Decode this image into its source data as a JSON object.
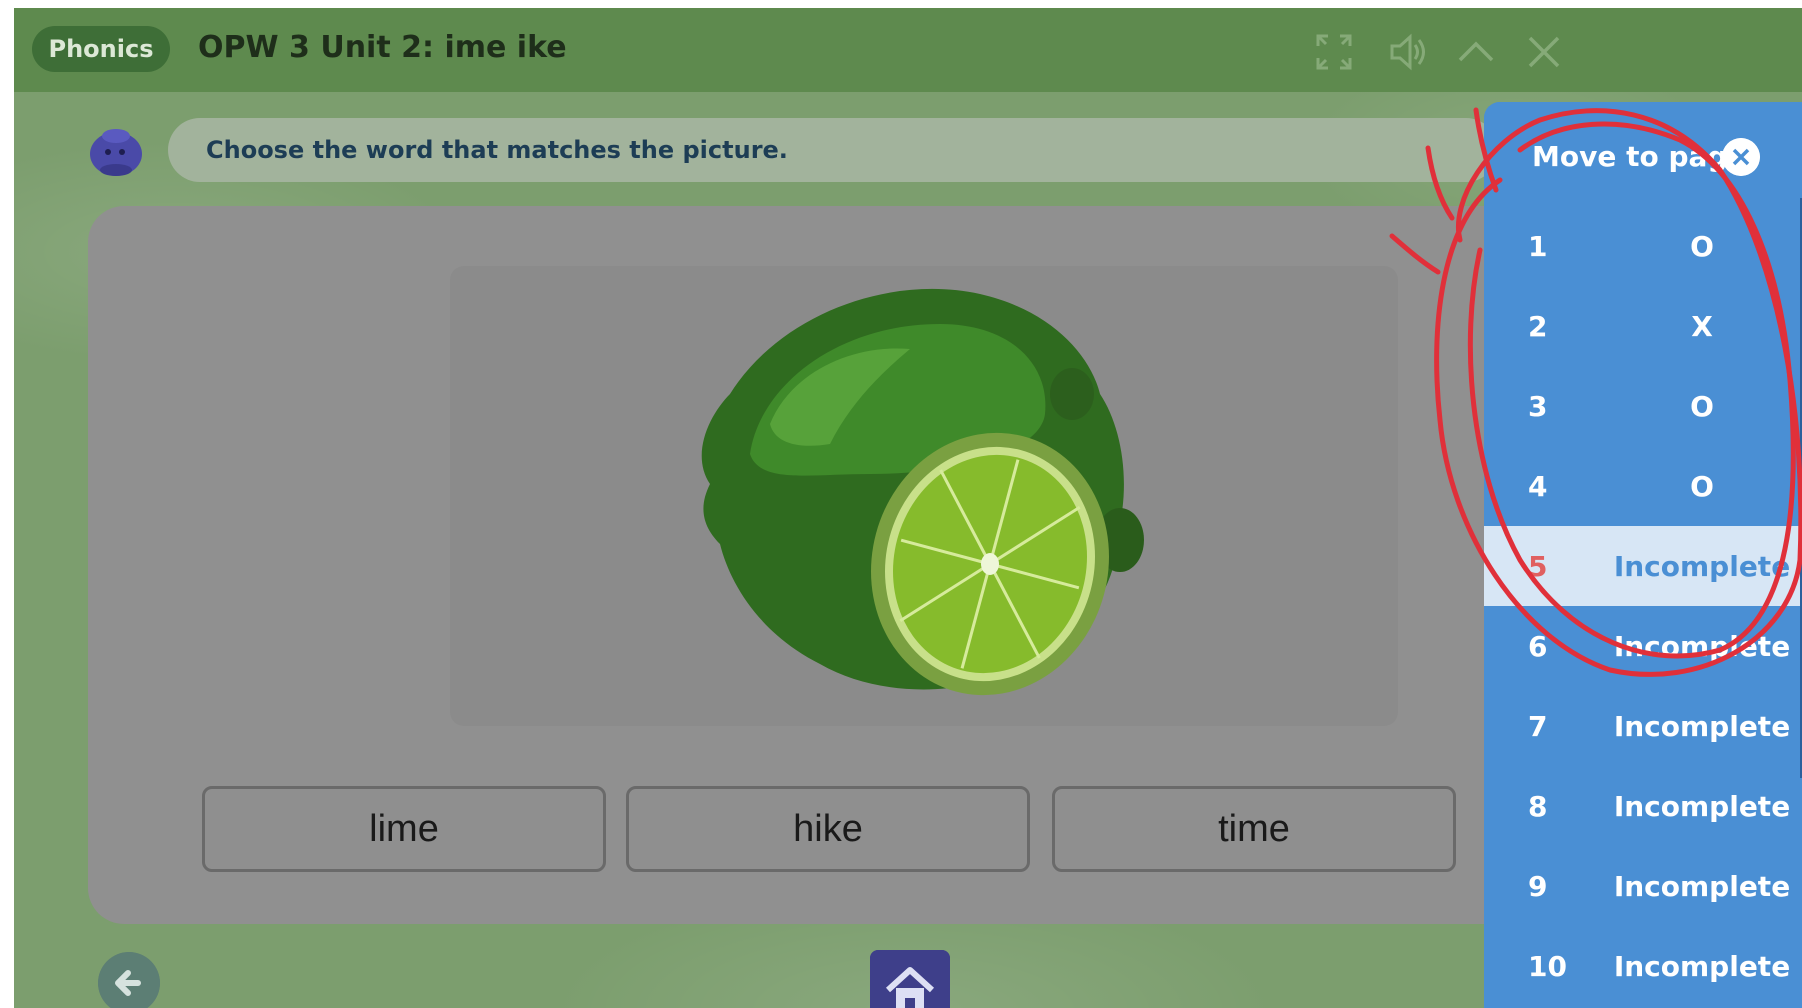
{
  "header": {
    "badge": "Phonics",
    "title": "OPW 3 Unit 2: ime ike",
    "icons": [
      "fullscreen-icon",
      "speaker-icon",
      "chevron-up-icon",
      "close-icon"
    ]
  },
  "instruction": "Choose the word that matches the picture.",
  "picture": {
    "subject": "lime-icon"
  },
  "choices": [
    "lime",
    "hike",
    "time"
  ],
  "page_panel": {
    "title": "Move to page",
    "current_page": 5,
    "pages": [
      {
        "number": "1",
        "status": "O"
      },
      {
        "number": "2",
        "status": "X"
      },
      {
        "number": "3",
        "status": "O"
      },
      {
        "number": "4",
        "status": "O"
      },
      {
        "number": "5",
        "status": "Incomplete"
      },
      {
        "number": "6",
        "status": "Incomplete"
      },
      {
        "number": "7",
        "status": "Incomplete"
      },
      {
        "number": "8",
        "status": "Incomplete"
      },
      {
        "number": "9",
        "status": "Incomplete"
      },
      {
        "number": "10",
        "status": "Incomplete"
      }
    ]
  },
  "colors": {
    "header": "#5e8a4e",
    "panel": "#4a8fd4",
    "current_row": "#d7e6f5",
    "annotation": "#e0303a"
  },
  "navigation": {
    "back_icon": "arrow-left-icon",
    "home_icon": "home-icon"
  }
}
